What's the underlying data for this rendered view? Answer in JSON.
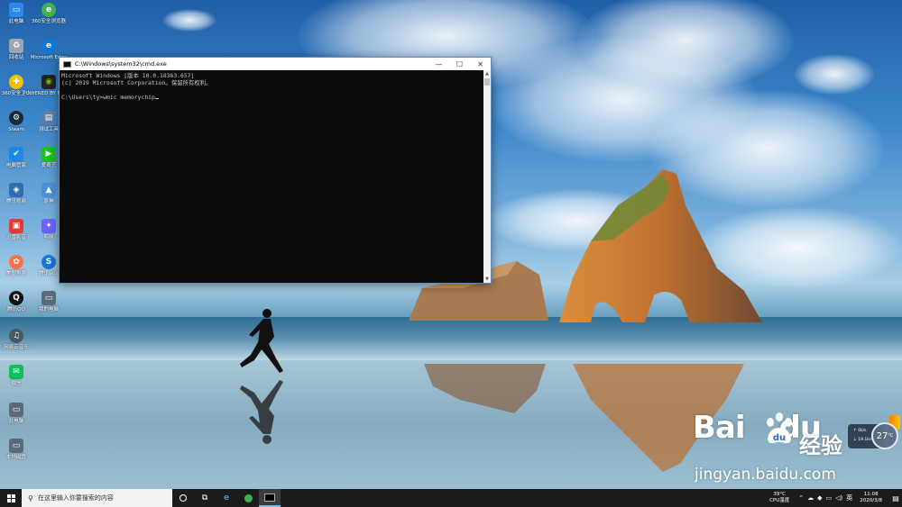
{
  "desktop": {
    "icons": [
      {
        "label": "此电脑",
        "icon": "computer-icon",
        "color": "#2d89ef"
      },
      {
        "label": "360安全浏览器",
        "icon": "browser-icon",
        "color": "#3fb34f"
      },
      {
        "label": "回收站",
        "icon": "recycle-bin-icon",
        "color": "#9aa7b3"
      },
      {
        "label": "Microsoft Edge",
        "icon": "edge-icon",
        "color": "#0a78d7"
      },
      {
        "label": "360安全卫士",
        "icon": "shield-icon",
        "color": "#f2c200"
      },
      {
        "label": "POWERED BY NVIDIA",
        "icon": "nvidia-icon",
        "color": "#76b900"
      },
      {
        "label": "Steam",
        "icon": "steam-icon",
        "color": "#1b2838"
      },
      {
        "label": "测试工具",
        "icon": "app-icon",
        "color": "#5b7fa6"
      },
      {
        "label": "电脑管家",
        "icon": "pc-manager-icon",
        "color": "#1e88e5"
      },
      {
        "label": "爱奇艺",
        "icon": "video-icon",
        "color": "#19c319"
      },
      {
        "label": "腾讯视频",
        "icon": "game-icon",
        "color": "#2f6db3"
      },
      {
        "label": "原神",
        "icon": "game-launcher-icon",
        "color": "#4a90d9"
      },
      {
        "label": "迅雷影音",
        "icon": "media-icon",
        "color": "#e53935"
      },
      {
        "label": "剪映",
        "icon": "editor-icon",
        "color": "#6c63ff"
      },
      {
        "label": "美图秀秀",
        "icon": "photo-icon",
        "color": "#ff7043"
      },
      {
        "label": "腾讯会议",
        "icon": "meeting-icon",
        "color": "#1976d2"
      },
      {
        "label": "腾讯QQ",
        "icon": "qq-icon",
        "color": "#111111"
      },
      {
        "label": "我的电脑",
        "icon": "computer-icon",
        "color": "#5c6b7a"
      },
      {
        "label": "网易云音乐",
        "icon": "music-icon",
        "color": "#455a64"
      },
      {
        "label": "微信",
        "icon": "wechat-icon",
        "color": "#07c160"
      },
      {
        "label": "此电脑",
        "icon": "computer-icon",
        "color": "#5c6b7a"
      },
      {
        "label": "本地磁盘",
        "icon": "computer-icon",
        "color": "#5c6b7a"
      }
    ]
  },
  "cmd": {
    "title": "C:\\Windows\\system32\\cmd.exe",
    "minimize": "—",
    "maximize": "☐",
    "close": "✕",
    "lines": [
      "Microsoft Windows [版本 10.0.18363.657]",
      "(c) 2019 Microsoft Corporation。保留所有权利。",
      "",
      "C:\\Users\\ty>wmic memorychip"
    ]
  },
  "widgets": {
    "net_up": "↑ 0k/s",
    "net_down": "↓ 19.1k/s",
    "temp": "27",
    "temp_unit": "°C"
  },
  "watermark": {
    "logo": "Bai",
    "logo2": "du",
    "cn": "经验",
    "url": "jingyan.baidu.com"
  },
  "taskbar": {
    "search_placeholder": "在这里输入你要搜索的内容",
    "cpu_temp": "39°C",
    "cpu_label": "CPU温度",
    "ime": "英",
    "time": "11:08",
    "date": "2020/3/8"
  }
}
